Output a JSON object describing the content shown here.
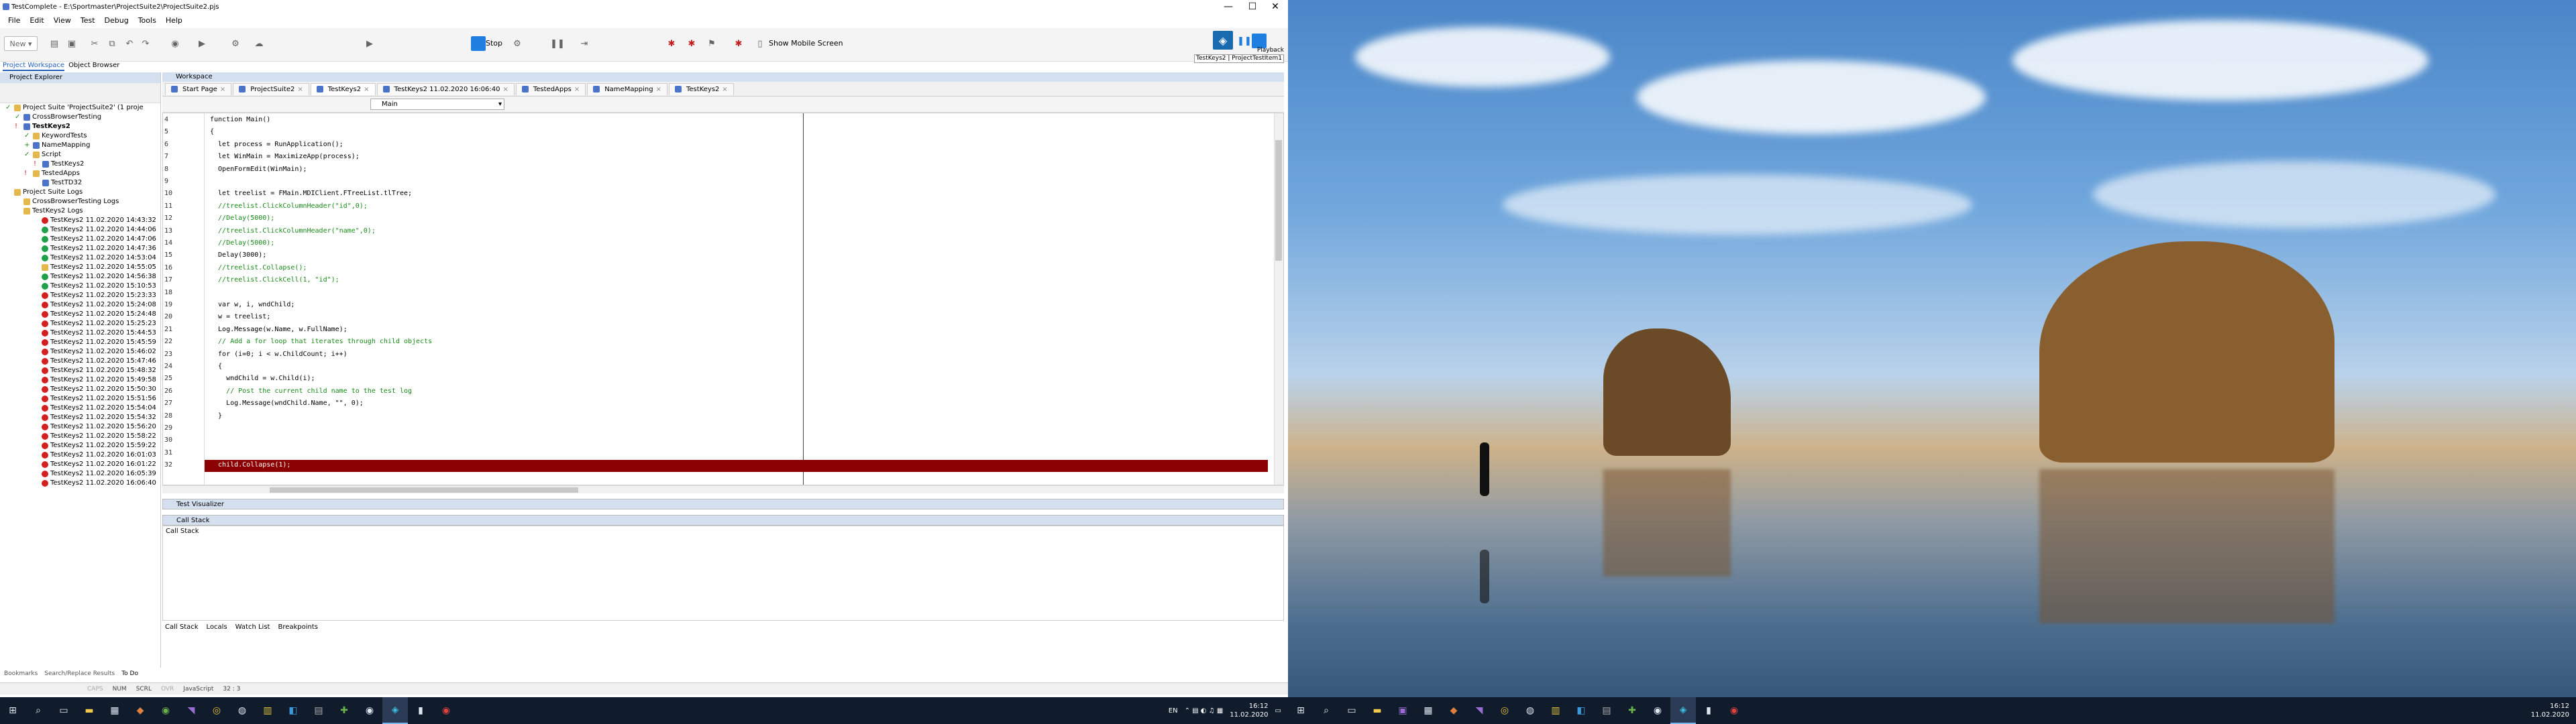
{
  "window": {
    "title": "TestComplete - E:\\Sportmaster\\ProjectSuite2\\ProjectSuite2.pjs",
    "controls": [
      "—",
      "☐",
      "✕"
    ]
  },
  "menu": [
    "File",
    "Edit",
    "View",
    "Test",
    "Debug",
    "Tools",
    "Help"
  ],
  "toolbar": {
    "new_label": "New",
    "stop_label": "Stop",
    "mobile_label": "Show Mobile Screen",
    "playback_label": "Playback",
    "playback_status": "TestKeys2 | ProjectTestItem1"
  },
  "panel_tabs": [
    "Project Workspace",
    "Object Browser"
  ],
  "explorer": {
    "title": "Project Explorer",
    "tree": [
      {
        "label": "Project Suite 'ProjectSuite2' (1 proje",
        "depth": 0,
        "icon": "fold",
        "check": "✓"
      },
      {
        "label": "CrossBrowserTesting",
        "depth": 1,
        "icon": "item",
        "check": "✓"
      },
      {
        "label": "TestKeys2",
        "depth": 1,
        "icon": "item",
        "check": "!",
        "bold": true
      },
      {
        "label": "KeywordTests",
        "depth": 2,
        "icon": "fold",
        "check": "✓"
      },
      {
        "label": "NameMapping",
        "depth": 2,
        "icon": "item",
        "check": "+"
      },
      {
        "label": "Script",
        "depth": 2,
        "icon": "fold",
        "check": "✓"
      },
      {
        "label": "TestKeys2",
        "depth": 3,
        "icon": "item",
        "check": "!"
      },
      {
        "label": "TestedApps",
        "depth": 2,
        "icon": "fold",
        "check": "!"
      },
      {
        "label": "TestTD32",
        "depth": 3,
        "icon": "item",
        "check": ""
      },
      {
        "label": "Project Suite Logs",
        "depth": 0,
        "icon": "fold",
        "check": ""
      },
      {
        "label": "CrossBrowserTesting Logs",
        "depth": 1,
        "icon": "fold",
        "check": ""
      },
      {
        "label": "TestKeys2 Logs",
        "depth": 1,
        "icon": "fold",
        "check": ""
      }
    ],
    "logs": [
      {
        "label": "TestKeys2 11.02.2020 14:43:32",
        "status": "err"
      },
      {
        "label": "TestKeys2 11.02.2020 14:44:06",
        "status": "ok"
      },
      {
        "label": "TestKeys2 11.02.2020 14:47:06",
        "status": "ok"
      },
      {
        "label": "TestKeys2 11.02.2020 14:47:36",
        "status": "ok"
      },
      {
        "label": "TestKeys2 11.02.2020 14:53:04",
        "status": "ok"
      },
      {
        "label": "TestKeys2 11.02.2020 14:55:05",
        "status": "warn"
      },
      {
        "label": "TestKeys2 11.02.2020 14:56:38",
        "status": "ok"
      },
      {
        "label": "TestKeys2 11.02.2020 15:10:53",
        "status": "ok"
      },
      {
        "label": "TestKeys2 11.02.2020 15:23:33",
        "status": "err"
      },
      {
        "label": "TestKeys2 11.02.2020 15:24:08",
        "status": "err"
      },
      {
        "label": "TestKeys2 11.02.2020 15:24:48",
        "status": "err"
      },
      {
        "label": "TestKeys2 11.02.2020 15:25:23",
        "status": "err"
      },
      {
        "label": "TestKeys2 11.02.2020 15:44:53",
        "status": "err"
      },
      {
        "label": "TestKeys2 11.02.2020 15:45:59",
        "status": "err"
      },
      {
        "label": "TestKeys2 11.02.2020 15:46:02",
        "status": "err"
      },
      {
        "label": "TestKeys2 11.02.2020 15:47:46",
        "status": "err"
      },
      {
        "label": "TestKeys2 11.02.2020 15:48:32",
        "status": "err"
      },
      {
        "label": "TestKeys2 11.02.2020 15:49:58",
        "status": "err"
      },
      {
        "label": "TestKeys2 11.02.2020 15:50:30",
        "status": "err"
      },
      {
        "label": "TestKeys2 11.02.2020 15:51:56",
        "status": "err"
      },
      {
        "label": "TestKeys2 11.02.2020 15:54:04",
        "status": "err"
      },
      {
        "label": "TestKeys2 11.02.2020 15:54:32",
        "status": "err"
      },
      {
        "label": "TestKeys2 11.02.2020 15:56:20",
        "status": "err"
      },
      {
        "label": "TestKeys2 11.02.2020 15:58:22",
        "status": "err"
      },
      {
        "label": "TestKeys2 11.02.2020 15:59:22",
        "status": "err"
      },
      {
        "label": "TestKeys2 11.02.2020 16:01:03",
        "status": "err"
      },
      {
        "label": "TestKeys2 11.02.2020 16:01:22",
        "status": "err"
      },
      {
        "label": "TestKeys2 11.02.2020 16:05:39",
        "status": "err"
      },
      {
        "label": "TestKeys2 11.02.2020 16:06:40",
        "status": "err"
      }
    ]
  },
  "workspace": {
    "title": "Workspace",
    "tabs": [
      {
        "label": "Start Page",
        "active": false
      },
      {
        "label": "ProjectSuite2",
        "active": false
      },
      {
        "label": "TestKeys2",
        "active": true
      },
      {
        "label": "TestKeys2 11.02.2020 16:06:40",
        "active": false
      },
      {
        "label": "TestedApps",
        "active": false
      },
      {
        "label": "NameMapping",
        "active": false
      },
      {
        "label": "TestKeys2",
        "active": false
      }
    ],
    "routine": "Main"
  },
  "code": [
    {
      "n": "4",
      "t": "function Main()"
    },
    {
      "n": "5",
      "t": "{"
    },
    {
      "n": "6",
      "t": "  let process = RunApplication();"
    },
    {
      "n": "7",
      "t": "  let WinMain = MaximizeApp(process);"
    },
    {
      "n": "8",
      "t": "  OpenFormEdit(WinMain);"
    },
    {
      "n": "9",
      "t": ""
    },
    {
      "n": "10",
      "t": "  let treelist = FMain.MDIClient.FTreeList.tlTree;"
    },
    {
      "n": "11",
      "t": "  //treelist.ClickColumnHeader(\"id\",0);",
      "c": "cm"
    },
    {
      "n": "12",
      "t": "  //Delay(5000);",
      "c": "cm"
    },
    {
      "n": "13",
      "t": "  //treelist.ClickColumnHeader(\"name\",0);",
      "c": "cm"
    },
    {
      "n": "14",
      "t": "  //Delay(5000);",
      "c": "cm"
    },
    {
      "n": "15",
      "t": "  Delay(3000);"
    },
    {
      "n": "16",
      "t": "  //treelist.Collapse();",
      "c": "cm"
    },
    {
      "n": "17",
      "t": "  //treelist.ClickCell(1, \"id\");",
      "c": "cm"
    },
    {
      "n": "18",
      "t": ""
    },
    {
      "n": "19",
      "t": "  var w, i, wndChild;"
    },
    {
      "n": "20",
      "t": "  w = treelist;"
    },
    {
      "n": "21",
      "t": "  Log.Message(w.Name, w.FullName);"
    },
    {
      "n": "22",
      "t": "  // Add a for loop that iterates through child objects",
      "c": "cm"
    },
    {
      "n": "23",
      "t": "  for (i=0; i < w.ChildCount; i++)"
    },
    {
      "n": "24",
      "t": "  {"
    },
    {
      "n": "25",
      "t": "    wndChild = w.Child(i);"
    },
    {
      "n": "26",
      "t": "    // Post the current child name to the test log",
      "c": "cm"
    },
    {
      "n": "27",
      "t": "    Log.Message(wndChild.Name, \"\", 0);"
    },
    {
      "n": "28",
      "t": "  }"
    },
    {
      "n": "29",
      "t": ""
    },
    {
      "n": "30",
      "t": ""
    },
    {
      "n": "31",
      "t": ""
    },
    {
      "n": "32",
      "t": "  child.Collapse(1);",
      "c": "hl"
    }
  ],
  "panels": {
    "visualizer": "Test Visualizer",
    "callstack_title": "Call Stack",
    "callstack_header": "Call Stack",
    "bottom_tabs": [
      "Call Stack",
      "Locals",
      "Watch List",
      "Breakpoints"
    ],
    "left_bottom_tabs": [
      "Bookmarks",
      "Search/Replace Results",
      "To Do"
    ]
  },
  "status": {
    "caps": "CAPS",
    "num": "NUM",
    "scrl": "SCRL",
    "ovr": "OVR",
    "lang": "JavaScript",
    "pos": "32 : 3"
  },
  "taskbar_left": {
    "lang": "EN",
    "time": "16:12",
    "date": "11.02.2020"
  },
  "taskbar_right": {
    "time": "16:12",
    "date": "11.02.2020"
  },
  "colors": {
    "highlight": "#8b0000",
    "taskbar": "#101c2c",
    "accent": "#1f5fbf"
  }
}
